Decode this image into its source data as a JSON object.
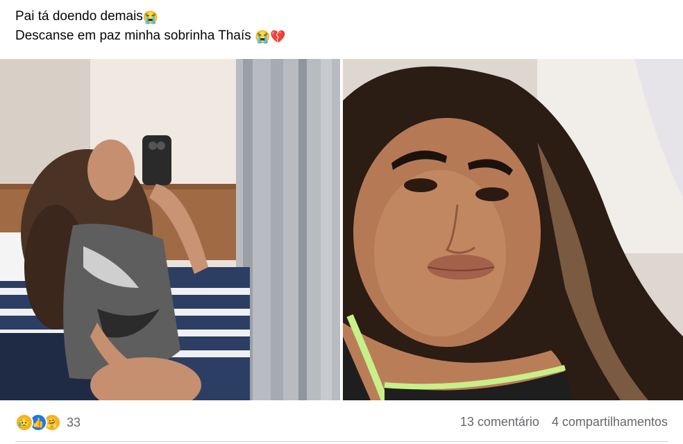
{
  "post": {
    "line1": "Pai tá doendo demais",
    "line1_emoji": "😭",
    "line2": "Descanse em paz minha sobrinha Thaís ",
    "line2_emoji1": "😭",
    "line2_emoji2": "💔"
  },
  "photos": [
    {
      "icon": "mirror-selfie-photo"
    },
    {
      "icon": "close-up-selfie-photo"
    }
  ],
  "reactions": {
    "icons": [
      "sad-emoji",
      "like-icon",
      "care-emoji"
    ],
    "sad_glyph": "😥",
    "like_glyph": "👍",
    "care_glyph": "🤗",
    "count": "33"
  },
  "stats": {
    "comments": "13 comentário",
    "shares": "4 compartilhamentos"
  }
}
